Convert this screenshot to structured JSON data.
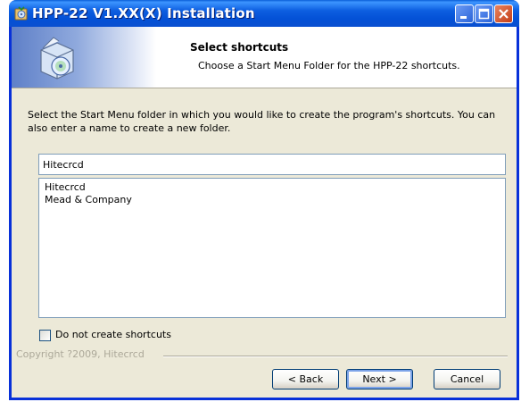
{
  "window": {
    "title": "HPP-22 V1.XX(X) Installation"
  },
  "header": {
    "title": "Select shortcuts",
    "subtitle": "Choose a Start Menu Folder for the HPP-22 shortcuts."
  },
  "body": {
    "intro": "Select the Start Menu folder in which you would like to create the program's shortcuts. You can also enter a name to create a new folder.",
    "folder_input_value": "Hitecrcd",
    "folder_list": [
      "Hitecrcd",
      "Mead & Company"
    ],
    "no_shortcuts_label": "Do not create shortcuts",
    "no_shortcuts_checked": false
  },
  "footer": {
    "copyright": "Copyright ?2009, Hitecrcd",
    "back_label": "< Back",
    "next_label": "Next >",
    "cancel_label": "Cancel"
  },
  "colors": {
    "titlebar": "#0451d6",
    "dialog_bg": "#ece9d8",
    "border": "#7f9db9"
  }
}
